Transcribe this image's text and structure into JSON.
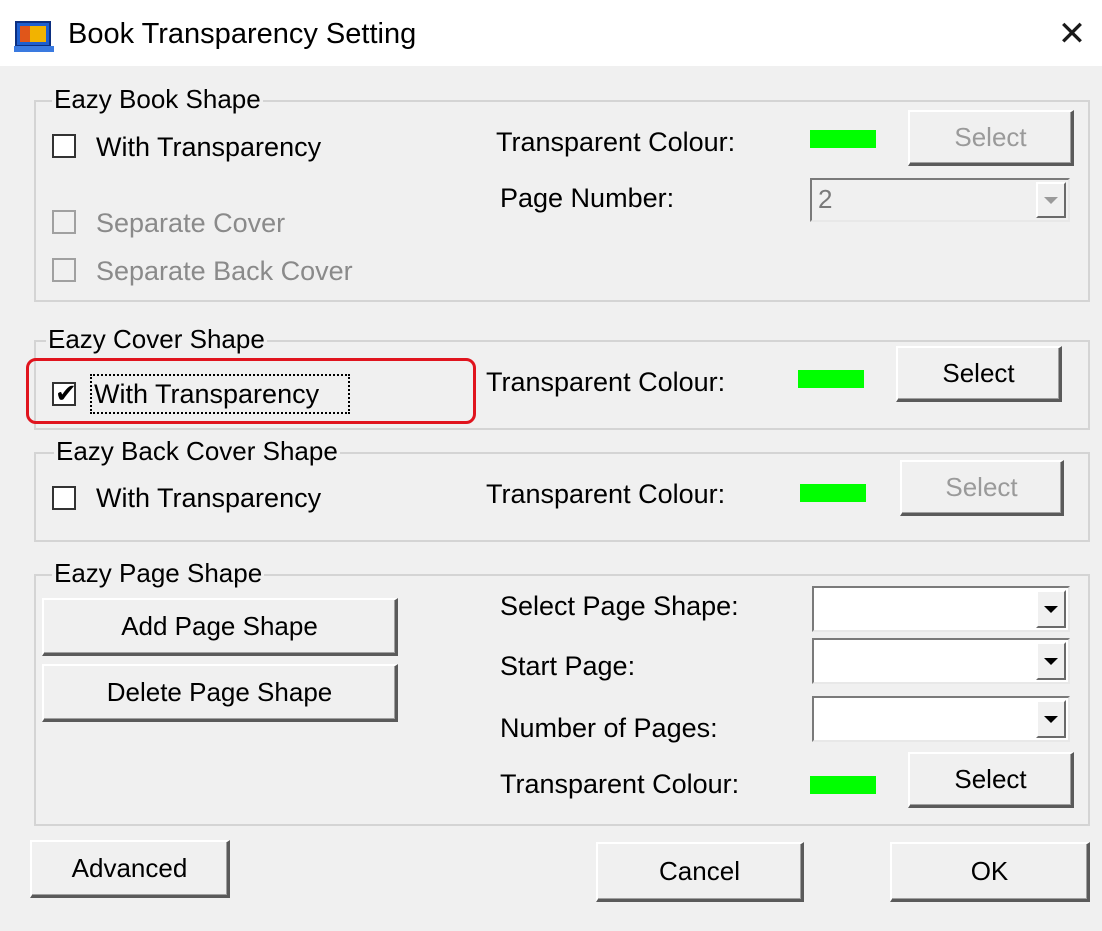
{
  "window": {
    "title": "Book Transparency Setting",
    "close_icon": "close-icon",
    "app_icon": "monitor-app-icon"
  },
  "book_shape": {
    "legend": "Eazy Book Shape",
    "with_transparency": {
      "label": "With Transparency",
      "checked": false
    },
    "separate_cover": {
      "label": "Separate Cover",
      "checked": false,
      "disabled": true
    },
    "separate_back_cover": {
      "label": "Separate Back Cover",
      "checked": false,
      "disabled": true
    },
    "transparent_colour_label": "Transparent Colour:",
    "colour": "#00ff00",
    "select_label": "Select",
    "page_number_label": "Page Number:",
    "page_number_value": "2"
  },
  "cover_shape": {
    "legend": "Eazy Cover Shape",
    "with_transparency": {
      "label": "With Transparency",
      "checked": true,
      "check_glyph": "✔"
    },
    "transparent_colour_label": "Transparent Colour:",
    "colour": "#00ff00",
    "select_label": "Select"
  },
  "back_cover_shape": {
    "legend": "Eazy Back Cover Shape",
    "with_transparency": {
      "label": "With Transparency",
      "checked": false
    },
    "transparent_colour_label": "Transparent Colour:",
    "colour": "#00ff00",
    "select_label": "Select"
  },
  "page_shape": {
    "legend": "Eazy Page Shape",
    "add_label": "Add Page Shape",
    "delete_label": "Delete Page Shape",
    "select_page_shape_label": "Select Page Shape:",
    "start_page_label": "Start Page:",
    "number_of_pages_label": "Number of Pages:",
    "transparent_colour_label": "Transparent Colour:",
    "colour": "#00ff00",
    "select_label": "Select"
  },
  "footer": {
    "advanced_label": "Advanced",
    "cancel_label": "Cancel",
    "ok_label": "OK"
  },
  "colors": {
    "highlight": "#e0141e",
    "dialog_bg": "#f0f0f0"
  }
}
